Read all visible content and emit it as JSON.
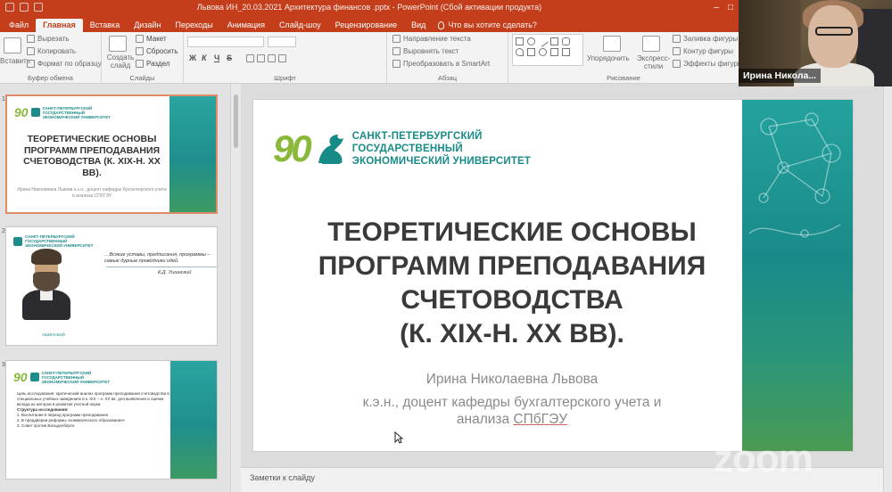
{
  "window": {
    "title": "Львова ИН_20.03.2021 Архитектура финансов .pptx - PowerPoint (Сбой активации продукта)"
  },
  "tabs": [
    {
      "label": "Файл"
    },
    {
      "label": "Главная",
      "active": true
    },
    {
      "label": "Вставка"
    },
    {
      "label": "Дизайн"
    },
    {
      "label": "Переходы"
    },
    {
      "label": "Анимация"
    },
    {
      "label": "Слайд-шоу"
    },
    {
      "label": "Рецензирование"
    },
    {
      "label": "Вид"
    }
  ],
  "tell_me": "Что вы хотите сделать?",
  "ribbon": {
    "clipboard": {
      "cut": "Вырезать",
      "copy": "Копировать",
      "format_painter": "Формат по образцу",
      "paste": "Вставить",
      "label": "Буфер обмена"
    },
    "slides": {
      "new_slide": "Создать слайд",
      "layout": "Макет",
      "reset": "Сбросить",
      "section": "Раздел",
      "label": "Слайды"
    },
    "font": {
      "bold": "Ж",
      "italic": "К",
      "underline": "Ч",
      "strike": "S",
      "label": "Шрифт"
    },
    "paragraph": {
      "text_direction": "Направление текста",
      "align_text": "Выровнять текст",
      "smartart": "Преобразовать в SmartArt",
      "label": "Абзац"
    },
    "drawing": {
      "arrange": "Упорядочить",
      "quick_styles": "Экспресс-стили",
      "shape_fill": "Заливка фигуры",
      "shape_outline": "Контур фигуры",
      "shape_effects": "Эффекты фигуры",
      "label": "Рисование"
    }
  },
  "thumbnails": [
    {
      "number": "1",
      "title": "ТЕОРЕТИЧЕСКИЕ ОСНОВЫ ПРОГРАММ ПРЕПОДАВАНИЯ СЧЕТОВОДСТВА (К. XIX-Н. XX ВВ).",
      "subtitle": "Ирина Николаевна Львова к.э.н., доцент кафедры бухгалтерского учета и анализа СПбГЭУ",
      "active": true
    },
    {
      "number": "2",
      "quote": "…Всякие уставы, предписания, программы – самые дурные проводники идей.",
      "author": "К.Д. Ушинский",
      "caption": "УШИНСКИЙ"
    },
    {
      "number": "3",
      "items": [
        "Цель исследования: критический анализ программ преподавания счетоводства в специальных учебных заведениях в к. XIX – н. XX вв. для выявления и оценки вклада их авторов в развитие учетной науки.",
        "Структура исследования:",
        "1. Воспитание в период программ преподавания",
        "2. В преддверии реформы «коммерческого образования»",
        "3. Совет против Вальденберга"
      ]
    }
  ],
  "university_logo": {
    "number": "90",
    "line1": "САНКТ-ПЕТЕРБУРГСКИЙ",
    "line2": "ГОСУДАРСТВЕННЫЙ",
    "line3": "ЭКОНОМИЧЕСКИЙ УНИВЕРСИТЕТ"
  },
  "slide": {
    "title_lines": [
      "ТЕОРЕТИЧЕСКИЕ ОСНОВЫ",
      "ПРОГРАММ ПРЕПОДАВАНИЯ",
      "СЧЕТОВОДСТВА",
      "(К. XIX-Н. XX ВВ)."
    ],
    "author": "Ирина Николаевна Львова",
    "position_line1": "к.э.н., доцент кафедры бухгалтерского учета и",
    "position_line2a": "анализа ",
    "position_line2b": "СПбГЭУ"
  },
  "notes_label": "Заметки к слайду",
  "webcam": {
    "participant": "Ирина Никола..."
  },
  "watermark": "zoom",
  "colors": {
    "accent": "#c43e1c",
    "teal": "#1d8c8a",
    "green": "#8ab83a"
  }
}
